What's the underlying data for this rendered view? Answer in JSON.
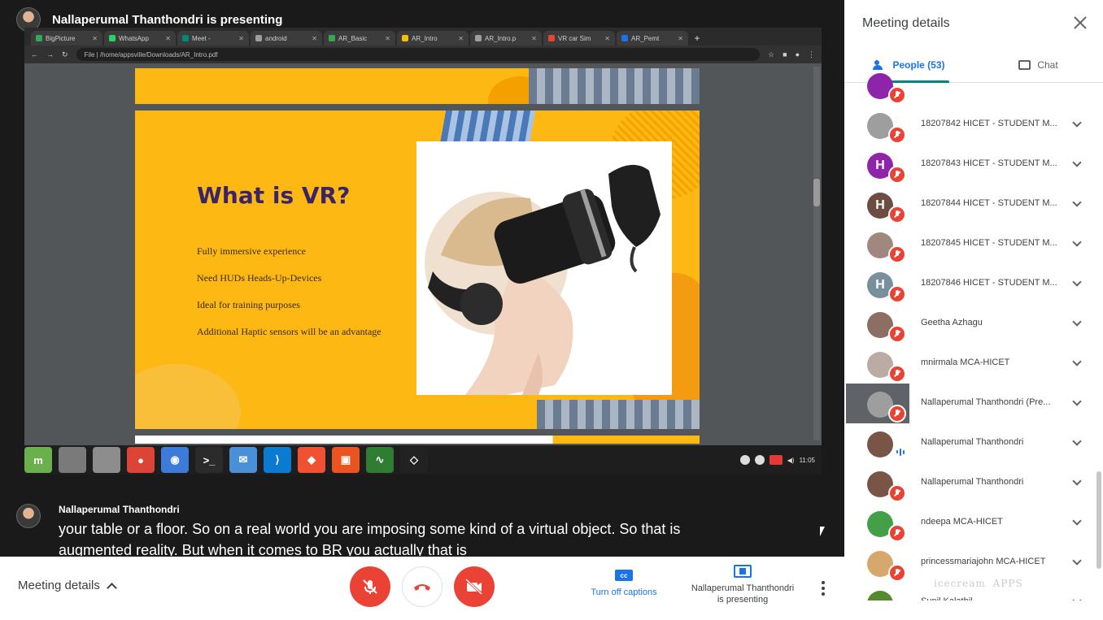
{
  "presenter": {
    "banner": "Nallaperumal Thanthondri is presenting"
  },
  "browser": {
    "tabs": [
      {
        "label": "BigPicture",
        "color": "#34a853"
      },
      {
        "label": "WhatsApp",
        "color": "#25d366"
      },
      {
        "label": "Meet -",
        "color": "#00897b"
      },
      {
        "label": "android",
        "color": "#9e9e9e"
      },
      {
        "label": "AR_Basic",
        "color": "#34a853"
      },
      {
        "label": "AR_Intro",
        "color": "#fbbc04"
      },
      {
        "label": "AR_Intro.p",
        "color": "#9e9e9e"
      },
      {
        "label": "VR car Sim",
        "color": "#ea4335"
      },
      {
        "label": "AR_Pemt",
        "color": "#1a73e8"
      }
    ],
    "new_tab": "+",
    "url": "File | /home/appsville/Downloads/AR_Intro.pdf"
  },
  "slide": {
    "title": "What is VR?",
    "bullets": [
      "Fully immersive experience",
      "Need HUDs Heads-Up-Devices",
      "Ideal for training purposes",
      "Additional Haptic sensors will be an advantage"
    ]
  },
  "taskbar": {
    "apps": [
      {
        "name": "linux-mint-menu-icon",
        "glyph": "m",
        "color": "#6ab04c"
      },
      {
        "name": "show-desktop-icon",
        "glyph": "",
        "color": "#7a7a7a"
      },
      {
        "name": "files-icon",
        "glyph": "",
        "color": "#8d8d8d"
      },
      {
        "name": "chrome-icon",
        "glyph": "●",
        "color": "#db4437"
      },
      {
        "name": "screenshot-icon",
        "glyph": "◉",
        "color": "#3d7bd9"
      },
      {
        "name": "terminal-icon",
        "glyph": ">_",
        "color": "#2b2b2b"
      },
      {
        "name": "mail-icon",
        "glyph": "✉",
        "color": "#4a90d9"
      },
      {
        "name": "vscode-icon",
        "glyph": "⟩",
        "color": "#0b7ad1"
      },
      {
        "name": "git-icon",
        "glyph": "◆",
        "color": "#f05133"
      },
      {
        "name": "screen-recorder-icon",
        "glyph": "▣",
        "color": "#e95420"
      },
      {
        "name": "system-monitor-icon",
        "glyph": "∿",
        "color": "#2e7d32"
      },
      {
        "name": "unity-icon",
        "glyph": "◇",
        "color": "#222222"
      }
    ],
    "clock": "11:05"
  },
  "captions": {
    "speaker": "Nallaperumal Thanthondri",
    "text": "your table or a floor. So on a real world you are imposing some kind of a virtual object. So that is augmented reality. But when it comes to BR you actually that is"
  },
  "bottom_bar": {
    "meeting_details": "Meeting details",
    "captions_button": "Turn off captions",
    "captions_icon": "cc",
    "presenting_line1": "Nallaperumal Thanthondri",
    "presenting_line2": "is presenting"
  },
  "panel": {
    "title": "Meeting details",
    "tab_people": "People (53)",
    "tab_chat": "Chat",
    "participants": [
      {
        "name": "",
        "initial": "",
        "color": "#8e24aa",
        "partial": true
      },
      {
        "name": "18207842 HICET - STUDENT M...",
        "initial": "",
        "color": "#9e9e9e"
      },
      {
        "name": "18207843 HICET - STUDENT M...",
        "initial": "H",
        "color": "#8e24aa"
      },
      {
        "name": "18207844 HICET - STUDENT M...",
        "initial": "H",
        "color": "#6d4c41"
      },
      {
        "name": "18207845 HICET - STUDENT M...",
        "initial": "",
        "color": "#a1887f"
      },
      {
        "name": "18207846 HICET - STUDENT M...",
        "initial": "H",
        "color": "#78909c"
      },
      {
        "name": "Geetha Azhagu",
        "initial": "",
        "color": "#8d6e63"
      },
      {
        "name": "mnirmala MCA-HICET",
        "initial": "",
        "color": "#bcaaa4"
      },
      {
        "name": "Nallaperumal Thanthondri (Pre...",
        "initial": "",
        "color": "#9e9e9e",
        "highlight": true
      },
      {
        "name": "Nallaperumal Thanthondri",
        "initial": "",
        "color": "#795548",
        "speaking": true
      },
      {
        "name": "Nallaperumal Thanthondri",
        "initial": "",
        "color": "#795548"
      },
      {
        "name": "ndeepa MCA-HICET",
        "initial": "",
        "color": "#43a047"
      },
      {
        "name": "princessmariajohn MCA-HICET",
        "initial": "",
        "color": "#d7a86e"
      },
      {
        "name": "Sunil Kalathil",
        "initial": "",
        "color": "#558b2f"
      }
    ],
    "watermark": "icecream",
    "watermark_sub": "APPS"
  }
}
